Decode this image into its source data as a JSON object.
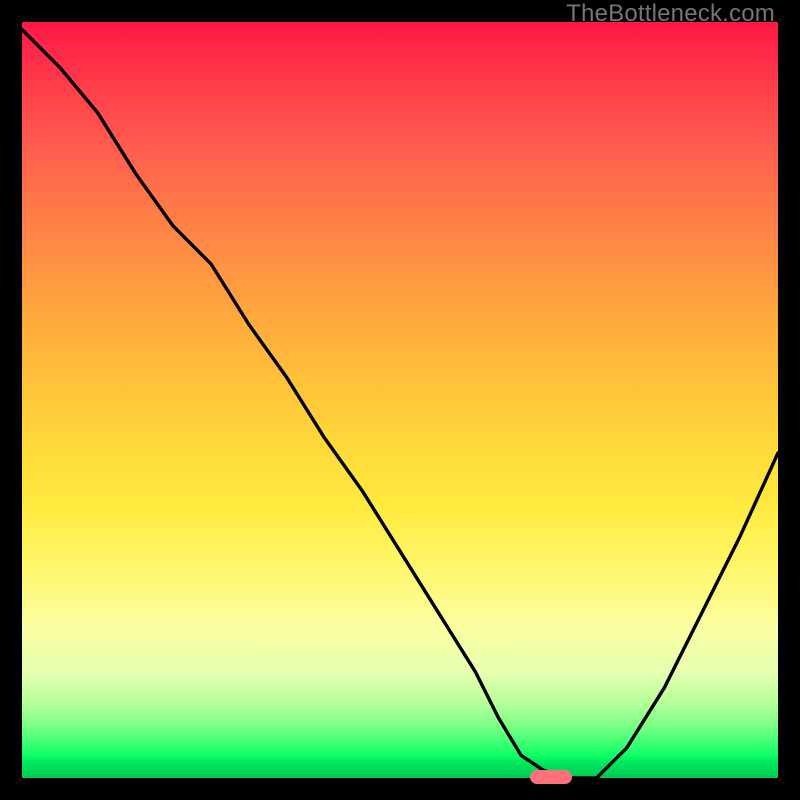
{
  "watermark": {
    "text": "TheBottleneck.com"
  },
  "chart_data": {
    "type": "line",
    "title": "",
    "xlabel": "",
    "ylabel": "",
    "xlim": [
      0,
      100
    ],
    "ylim": [
      0,
      100
    ],
    "grid": false,
    "legend": null,
    "series": [
      {
        "name": "bottleneck-curve",
        "color": "#000000",
        "x": [
          0,
          5,
          10,
          15,
          20,
          25,
          30,
          35,
          40,
          45,
          50,
          55,
          60,
          63,
          66,
          69,
          72,
          76,
          80,
          85,
          90,
          95,
          100
        ],
        "y": [
          99,
          94,
          88,
          80,
          73,
          68,
          60,
          53,
          45,
          38,
          30,
          22,
          14,
          8,
          3,
          1,
          0,
          0,
          4,
          12,
          22,
          32,
          43
        ]
      }
    ],
    "marker": {
      "name": "optimal-range-marker",
      "color": "#ff707a",
      "x_center": 70,
      "y": 0,
      "width_x_units": 5.5
    },
    "background_gradient": {
      "top": "#ff1744",
      "bottom": "#00c853",
      "stops": [
        "#ff1744",
        "#ff7848",
        "#ffd93a",
        "#fff76a",
        "#b8ff9a",
        "#00c853"
      ]
    }
  }
}
